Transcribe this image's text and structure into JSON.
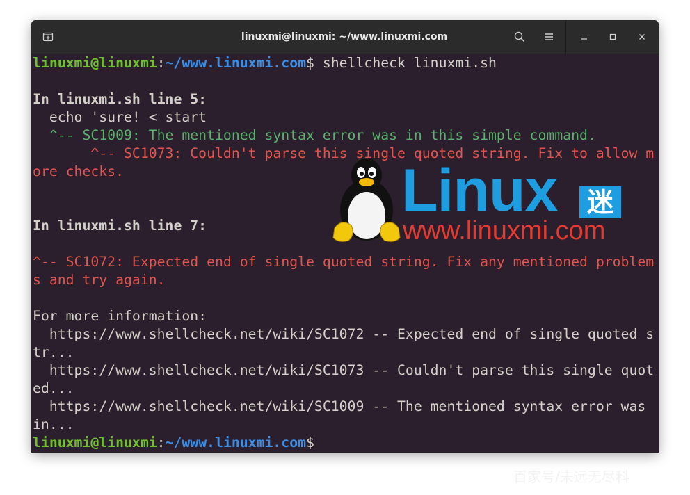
{
  "window": {
    "title": "linuxmi@linuxmi: ~/www.linuxmi.com",
    "icons": [
      "new-tab-icon",
      "search-icon",
      "hamburger-menu-icon",
      "minimize-icon",
      "maximize-icon",
      "close-icon"
    ]
  },
  "colors": {
    "background": "#2c1f2d",
    "prompt_user": "#6ec12a",
    "prompt_path": "#3a8ee6",
    "text": "#d3d0c8",
    "info": "#57b36b",
    "error": "#e0554e"
  },
  "terminal": {
    "prompt_user": "linuxmi@linuxmi",
    "prompt_sep": ":",
    "prompt_path": "~/www.linuxmi.com",
    "prompt_dollar": "$",
    "command": " shellcheck linuxmi.sh",
    "header1": "In linuxmi.sh line 5:",
    "code1": "  echo 'sure! < start",
    "note1": "  ^-- SC1009: The mentioned syntax error was in this simple command.",
    "err1a": "       ^-- SC1073: Couldn't parse this single quoted string. Fix to allow m",
    "err1b": "ore checks.",
    "header2": "In linuxmi.sh line 7:",
    "err2a": "^-- SC1072: Expected end of single quoted string. Fix any mentioned problem",
    "err2b": "s and try again.",
    "more": "For more information:",
    "link1a": "  https://www.shellcheck.net/wiki/SC1072 -- Expected end of single quoted s",
    "link1b": "tr...",
    "link2a": "  https://www.shellcheck.net/wiki/SC1073 -- Couldn't parse this single quot",
    "link2b": "ed...",
    "link3a": "  https://www.shellcheck.net/wiki/SC1009 -- The mentioned syntax error was",
    "link3b": "in..."
  },
  "logo": {
    "name": "Linux",
    "mi": "迷",
    "url": "www.linuxmi.com"
  },
  "watermark": "百家号/未远无尽科"
}
